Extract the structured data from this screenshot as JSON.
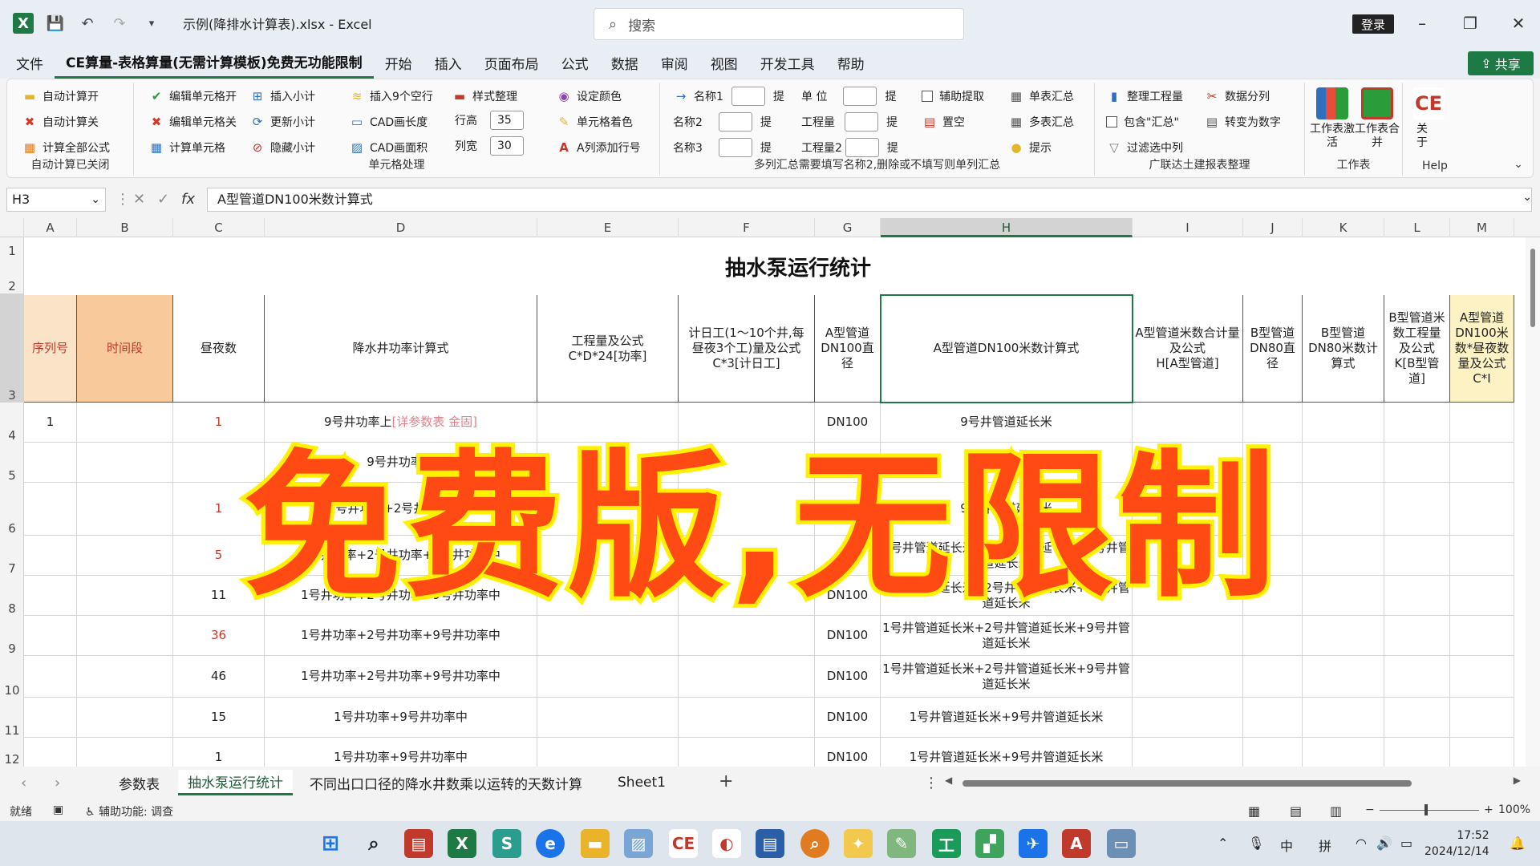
{
  "titlebar": {
    "doc_title": "示例(降排水计算表).xlsx - Excel",
    "search_placeholder": "搜索",
    "login": "登录"
  },
  "menu": [
    "文件",
    "CE算量-表格算量(无需计算模板)免费无功能限制",
    "开始",
    "插入",
    "页面布局",
    "公式",
    "数据",
    "审阅",
    "视图",
    "开发工具",
    "帮助"
  ],
  "share": "共享",
  "ribbon": {
    "g1": {
      "items": [
        "自动计算开",
        "自动计算关",
        "计算全部公式"
      ],
      "label": "自动计算已关闭"
    },
    "g2": {
      "items": [
        "编辑单元格开",
        "编辑单元格关",
        "计算单元格",
        "插入小计",
        "更新小计",
        "隐藏小计",
        "插入9个空行",
        "CAD画长度",
        "CAD画面积",
        "样式整理",
        "行高",
        "列宽",
        "设定颜色",
        "单元格着色",
        "A列添加行号"
      ],
      "row_height": "35",
      "col_width": "30",
      "label": "单元格处理"
    },
    "g3": {
      "items": [
        "名称1",
        "名称2",
        "名称3",
        "提",
        "提",
        "提",
        "单 位",
        "工程量",
        "工程量2",
        "提",
        "提",
        "提",
        "辅助提取",
        "置空",
        "单表汇总",
        "多表汇总",
        "提示"
      ],
      "label": "多列汇总需要填写名称2,删除或不填写则单列汇总"
    },
    "g4": {
      "items": [
        "整理工程量",
        "包含\"汇总\"",
        "过滤选中列",
        "数据分列",
        "转变为数字"
      ],
      "label": "广联达土建报表整理"
    },
    "g5": {
      "items": [
        "工作表激活",
        "工作表合并"
      ],
      "label": "工作表"
    },
    "g6": {
      "items": [
        "关于"
      ],
      "label": "Help"
    }
  },
  "formula_bar": {
    "name_box": "H3",
    "formula": "A型管道DN100米数计算式"
  },
  "columns": [
    "A",
    "B",
    "C",
    "D",
    "E",
    "F",
    "G",
    "H",
    "I",
    "J",
    "K",
    "L",
    "M"
  ],
  "rows": [
    "1",
    "2",
    "3",
    "4",
    "5",
    "6",
    "7",
    "8",
    "9",
    "10",
    "11",
    "12"
  ],
  "sheet": {
    "title": "抽水泵运行统计",
    "headers": [
      "序列号",
      "时间段",
      "昼夜数",
      "降水井功率计算式",
      "工程量及公式\nC*D*24[功率]",
      "计日工(1～10个井,每昼夜3个工)量及公式\nC*3[计日工]",
      "A型管道DN100直径",
      "A型管道DN100米数计算式",
      "A型管道米数合计量及公式\nH[A型管道]",
      "B型管道DN80直径",
      "B型管道DN80米数计算式",
      "B型管道米数工程量及公式\nK[B型管道]",
      "A型管道DN100米数*昼夜数量及公式\nC*I"
    ],
    "data": [
      {
        "a": "1",
        "c": "1",
        "d": "9号井功率上",
        "d2": "[详参数表 金固]",
        "g": "DN100",
        "h": "9号井管道延长米"
      },
      {
        "a": "",
        "c": "",
        "d": "9号井功率中",
        "d2": "",
        "g": "",
        "h": ""
      },
      {
        "a": "",
        "c": "1",
        "d": "1号井功率+2号井功率",
        "d2": "分别",
        "g": "",
        "h": "9号井管道延长米"
      },
      {
        "a": "",
        "c": "5",
        "d": "1号井功率+2号井功率+9号井功率中",
        "d2": "",
        "g": "",
        "h": "1号井管道延长米+2号井管道延长米+3号井管道延长米"
      },
      {
        "a": "",
        "c": "11",
        "d": "1号井功率+2号井功率+9号井功率中",
        "d2": "",
        "g": "DN100",
        "h": "1号井管道延长米+2号井管道延长米+9号井管道延长米"
      },
      {
        "a": "",
        "c": "36",
        "d": "1号井功率+2号井功率+9号井功率中",
        "d2": "",
        "g": "DN100",
        "h": "1号井管道延长米+2号井管道延长米+9号井管道延长米"
      },
      {
        "a": "",
        "c": "46",
        "d": "1号井功率+2号井功率+9号井功率中",
        "d2": "",
        "g": "DN100",
        "h": "1号井管道延长米+2号井管道延长米+9号井管道延长米"
      },
      {
        "a": "",
        "c": "15",
        "d": "1号井功率+9号井功率中",
        "d2": "",
        "g": "DN100",
        "h": "1号井管道延长米+9号井管道延长米"
      },
      {
        "a": "",
        "c": "1",
        "d": "1号井功率+9号井功率中",
        "d2": "",
        "g": "DN100",
        "h": "1号井管道延长米+9号井管道延长米"
      }
    ]
  },
  "overlay_text": "免费版,无限制",
  "sheet_tabs": [
    "参数表",
    "抽水泵运行统计",
    "不同出口口径的降水井数乘以运转的天数计算",
    "Sheet1"
  ],
  "status": {
    "ready": "就绪",
    "accessibility": "辅助功能: 调查",
    "zoom": "100%"
  },
  "clock": {
    "time": "17:52",
    "date": "2024/12/14"
  },
  "tray": {
    "ime1": "中",
    "ime2": "拼"
  }
}
